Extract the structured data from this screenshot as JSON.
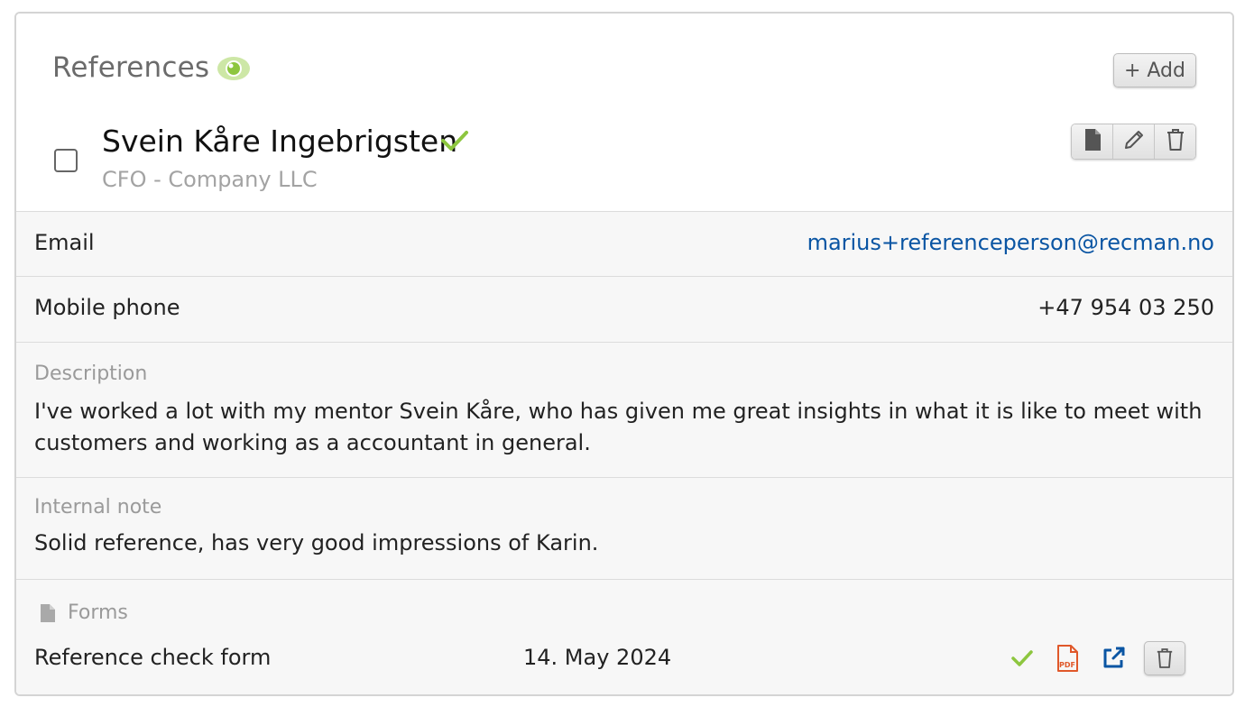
{
  "section": {
    "title": "References",
    "add_label": "+ Add"
  },
  "reference": {
    "name": "Svein Kåre Ingebrigsten",
    "subtitle": "CFO - Company LLC",
    "verified": true
  },
  "details": {
    "email_label": "Email",
    "email_value": "marius+referenceperson@recman.no",
    "phone_label": "Mobile phone",
    "phone_value": "+47 954 03 250",
    "description_label": "Description",
    "description_text": "I've worked a lot with my mentor Svein Kåre, who has given me great insights in what it is like to meet with customers and working as a accountant in general.",
    "note_label": "Internal note",
    "note_text": "Solid reference, has very good impressions of Karin."
  },
  "forms": {
    "label": "Forms",
    "items": [
      {
        "name": "Reference check form",
        "date": "14. May 2024",
        "completed": true
      }
    ]
  },
  "colors": {
    "accent_green": "#8dc63f",
    "link_blue": "#0a55a3",
    "pdf_orange": "#e0582a"
  },
  "icons": [
    "eye-icon",
    "check-icon",
    "file-icon",
    "pencil-icon",
    "trash-icon",
    "pdf-icon",
    "external-link-icon"
  ]
}
